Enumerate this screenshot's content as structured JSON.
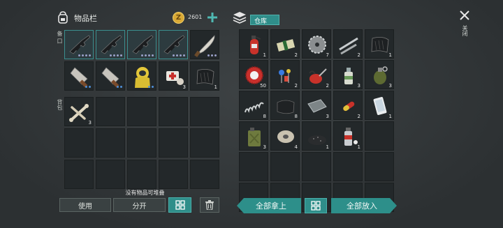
{
  "inventory": {
    "title": "物品栏",
    "currency": "2601",
    "equip_label": "装备",
    "equip_label_display": "备 口",
    "bag_label": "背包",
    "no_stack_text": "没有物品可堆叠",
    "use_button": "使用",
    "split_button": "分开",
    "equip_slots": [
      {
        "icon": "assault-rifle-icon",
        "dots": [
          "p",
          "p",
          "p",
          "p"
        ],
        "qty": ""
      },
      {
        "icon": "assault-rifle-icon",
        "dots": [
          "p",
          "p",
          "p",
          "p"
        ],
        "qty": ""
      },
      {
        "icon": "assault-rifle-icon",
        "dots": [
          "p",
          "p",
          "p",
          "p"
        ],
        "qty": ""
      },
      {
        "icon": "assault-rifle-icon",
        "dots": [
          "p",
          "p",
          "p",
          "p"
        ],
        "qty": ""
      },
      {
        "icon": "machete-icon",
        "dots": [
          "p",
          "p",
          "p"
        ],
        "qty": ""
      },
      {
        "icon": "cleaver-icon",
        "dots": [
          "b",
          "b"
        ],
        "qty": ""
      },
      {
        "icon": "cleaver-icon",
        "dots": [
          "b",
          "b"
        ],
        "qty": ""
      },
      {
        "icon": "hazmat-suit-icon",
        "dots": [
          "b",
          "b"
        ],
        "qty": ""
      },
      {
        "icon": "medkit-icon",
        "dots": [],
        "qty": "3"
      },
      {
        "icon": "tarp-icon",
        "dots": [],
        "qty": "1"
      }
    ],
    "bag_slots": [
      {
        "icon": "bones-icon",
        "qty": "3"
      }
    ]
  },
  "storage": {
    "title": "仓库",
    "close_label": "关闭",
    "take_all_button": "全部拿上",
    "put_all_button": "全部放入",
    "slots": [
      {
        "icon": "fire-extinguisher-icon",
        "qty": "1"
      },
      {
        "icon": "cash-bundle-icon",
        "qty": "2"
      },
      {
        "icon": "saw-blade-icon",
        "qty": "7"
      },
      {
        "icon": "pipes-icon",
        "qty": "2"
      },
      {
        "icon": "tarp-icon",
        "qty": "1"
      },
      {
        "icon": "bottle-cap-icon",
        "qty": "50"
      },
      {
        "icon": "circuit-parts-icon",
        "qty": "2"
      },
      {
        "icon": "oil-can-icon",
        "qty": "2"
      },
      {
        "icon": "glue-bottle-icon",
        "qty": "3"
      },
      {
        "icon": "grenade-icon",
        "qty": "3"
      },
      {
        "icon": "spring-icon",
        "qty": "8"
      },
      {
        "icon": "leather-icon",
        "qty": "8"
      },
      {
        "icon": "metal-plate-icon",
        "qty": "3"
      },
      {
        "icon": "pill-capsule-icon",
        "qty": "2"
      },
      {
        "icon": "smartphone-icon",
        "qty": "1"
      },
      {
        "icon": "jerrycan-icon",
        "qty": "3"
      },
      {
        "icon": "wire-spool-icon",
        "qty": "4"
      },
      {
        "icon": "gunpowder-icon",
        "qty": "1"
      },
      {
        "icon": "spray-can-icon",
        "qty": "1"
      }
    ]
  },
  "colors": {
    "accent": "#2f8e8a",
    "gold": "#e0b23a",
    "slot": "#23282a"
  }
}
